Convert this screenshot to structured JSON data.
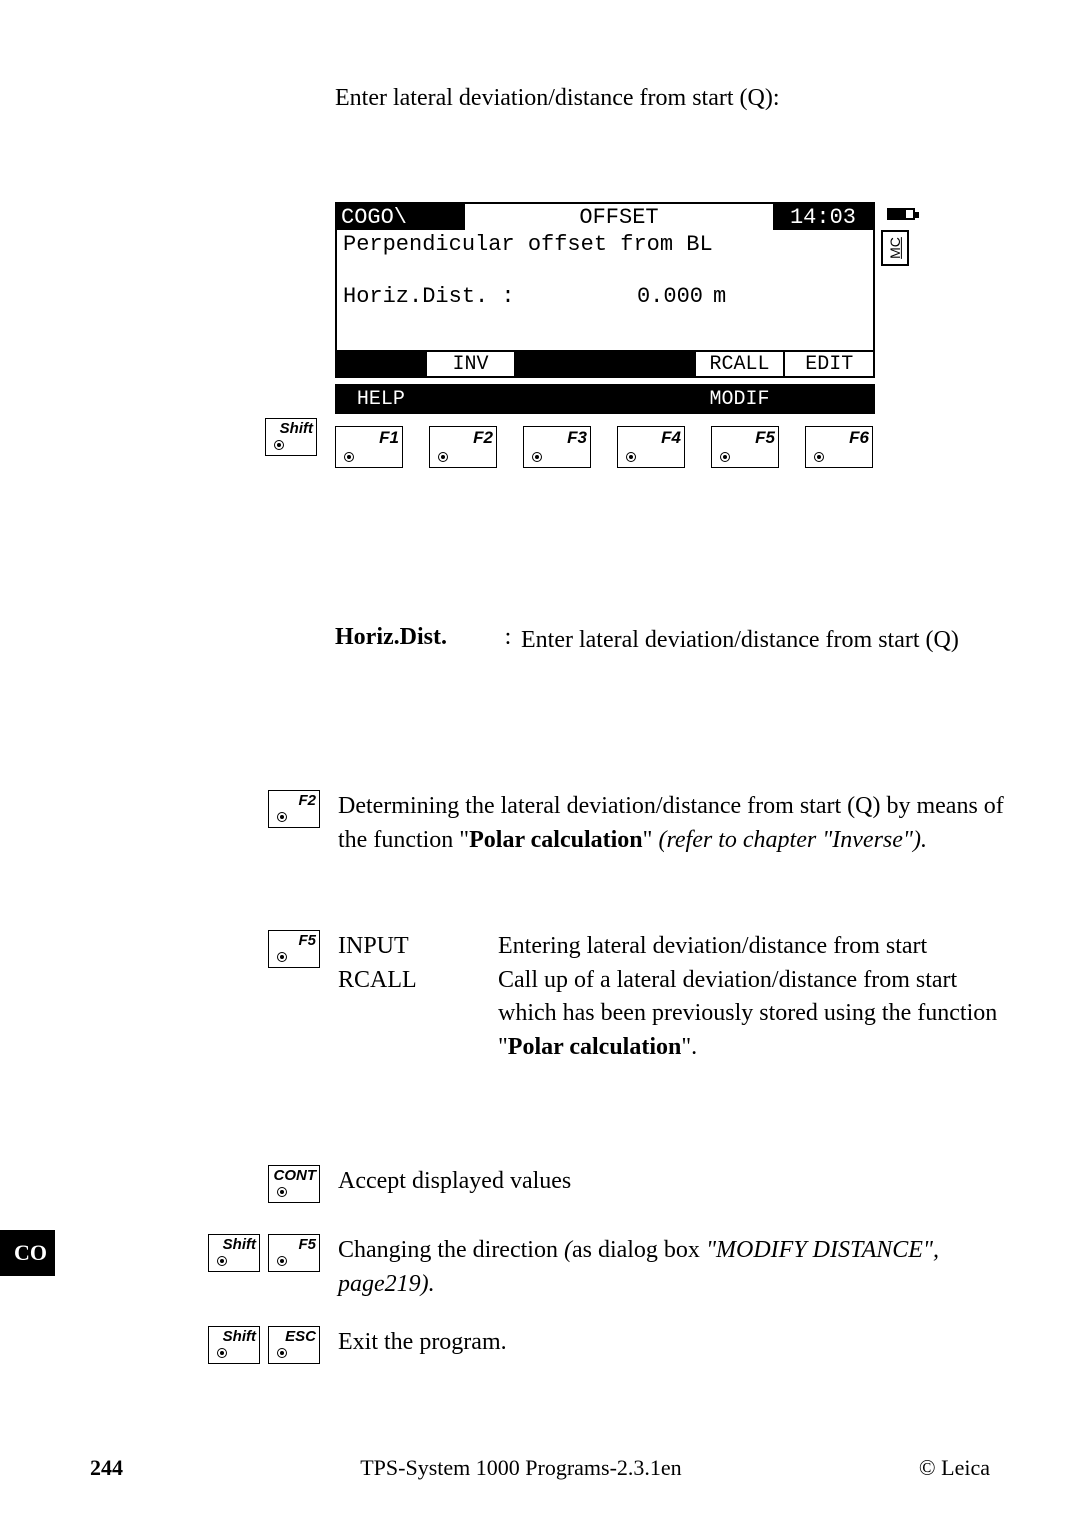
{
  "page_title": "Enter lateral deviation/distance from start (Q):",
  "lcd": {
    "breadcrumb": "COGO\\",
    "mode": "OFFSET",
    "time": "14:03",
    "subtitle": "Perpendicular offset from BL",
    "field_label": "Horiz.Dist. :",
    "field_value": "0.000",
    "field_unit": "m",
    "mc": "MC",
    "softkeys_main": {
      "f1": "",
      "f2": "INV",
      "f3": "",
      "f4": "",
      "f5": "RCALL",
      "f6": "EDIT"
    },
    "softkeys_shift": {
      "f1": "HELP",
      "f2": "",
      "f3": "",
      "f4": "",
      "f5": "MODIF",
      "f6": ""
    }
  },
  "keys": {
    "shift": "Shift",
    "f1": "F1",
    "f2": "F2",
    "f3": "F3",
    "f4": "F4",
    "f5": "F5",
    "f6": "F6",
    "cont": "CONT",
    "esc": "ESC"
  },
  "defs": {
    "horiz_term": "Horiz.Dist.",
    "horiz_colon": ":",
    "horiz_def": "Enter lateral deviation/distance from start (Q)"
  },
  "expl": {
    "f2_text_a": "Determining the lateral deviation/distance from start (Q) by means of the function \"",
    "f2_bold": "Polar calculation",
    "f2_text_b": "\" ",
    "f2_italic": "(refer to chapter \"Inverse\").",
    "f5_input_term": "INPUT",
    "f5_input_def": "Entering lateral deviation/distance from start",
    "f5_rcall_term": "RCALL",
    "f5_rcall_def_a": "Call up of a lateral deviation/distance from start which has been previously stored using the function \"",
    "f5_rcall_bold": "Polar calculation",
    "f5_rcall_def_b": "\".",
    "cont_text": "Accept displayed values",
    "shift_f5_a": "Changing the direction ",
    "shift_f5_i1": "(",
    "shift_f5_b": "as dialog box ",
    "shift_f5_i2": "\"MODIFY DISTANCE\", page219).",
    "shift_esc": "Exit the program."
  },
  "co_tab": "CO",
  "footer": {
    "page": "244",
    "title": "TPS-System 1000 Programs-2.3.1en",
    "copy": "© Leica"
  }
}
